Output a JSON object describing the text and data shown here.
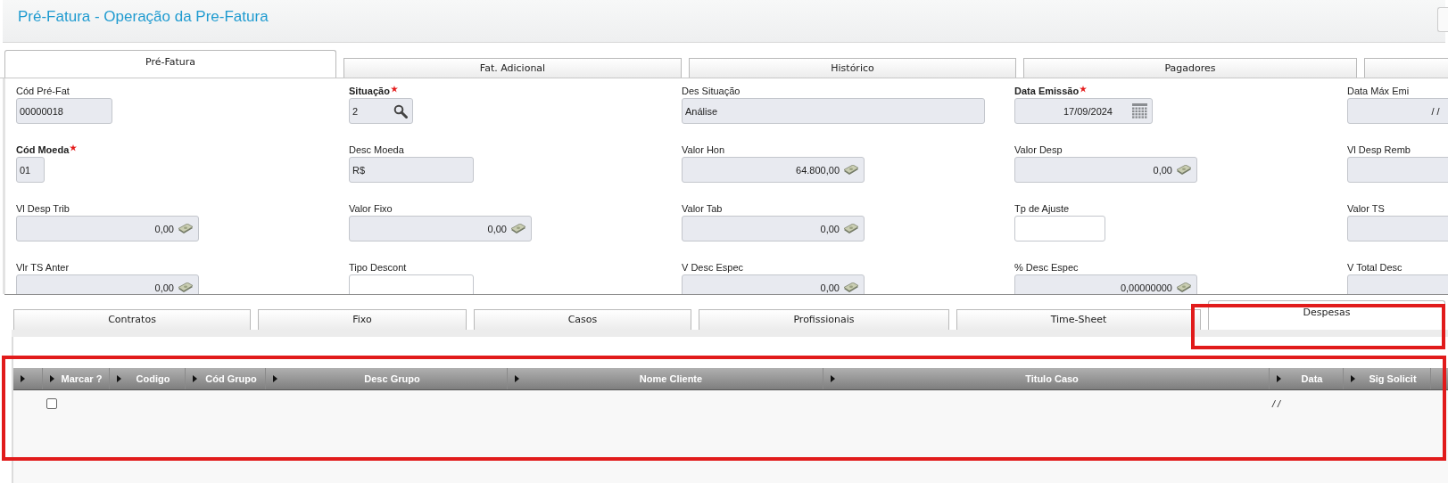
{
  "window": {
    "title": "Pré-Fatura - Operação da Pre-Fatura"
  },
  "tabs": [
    {
      "label": "Pré-Fatura",
      "selected": true
    },
    {
      "label": "Fat. Adicional",
      "selected": false
    },
    {
      "label": "Histórico",
      "selected": false
    },
    {
      "label": "Pagadores",
      "selected": false
    }
  ],
  "form": {
    "rows": [
      [
        {
          "label": "Cód Pré-Fat",
          "required": false,
          "kind": "text",
          "editable": false,
          "value": "00000018"
        },
        {
          "label": "Situação",
          "required": true,
          "kind": "lookup",
          "editable": false,
          "value": "2"
        },
        {
          "label": "Des Situação",
          "required": false,
          "kind": "text",
          "editable": false,
          "value": "Análise"
        },
        {
          "label": "Data Emissão",
          "required": true,
          "kind": "date",
          "editable": false,
          "value": "17/09/2024"
        },
        {
          "label": "Data Máx Emi",
          "required": false,
          "kind": "date-plain",
          "editable": false,
          "value": "/ /"
        }
      ],
      [
        {
          "label": "Cód Moeda",
          "required": true,
          "kind": "text",
          "editable": false,
          "value": "01"
        },
        {
          "label": "Desc Moeda",
          "required": false,
          "kind": "text",
          "editable": false,
          "value": "R$"
        },
        {
          "label": "Valor Hon",
          "required": false,
          "kind": "money",
          "editable": false,
          "value": "64.800,00"
        },
        {
          "label": "Valor Desp",
          "required": false,
          "kind": "money",
          "editable": false,
          "value": "0,00"
        },
        {
          "label": "Vl Desp Remb",
          "required": false,
          "kind": "text",
          "editable": false
        }
      ],
      [
        {
          "label": "Vl Desp Trib",
          "required": false,
          "kind": "money",
          "editable": false,
          "value": "0,00"
        },
        {
          "label": "Valor Fixo",
          "required": false,
          "kind": "money",
          "editable": false,
          "value": "0,00"
        },
        {
          "label": "Valor Tab",
          "required": false,
          "kind": "money",
          "editable": false,
          "value": "0,00"
        },
        {
          "label": "Tp de Ajuste",
          "required": false,
          "kind": "text",
          "editable": true
        },
        {
          "label": "Valor TS",
          "required": false,
          "kind": "text",
          "editable": false
        }
      ],
      [
        {
          "label": "Vlr TS Anter",
          "required": false,
          "kind": "money",
          "editable": false,
          "value": "0,00"
        },
        {
          "label": "Tipo Descont",
          "required": false,
          "kind": "text",
          "editable": true
        },
        {
          "label": "V Desc Espec",
          "required": false,
          "kind": "money",
          "editable": false,
          "value": "0,00"
        },
        {
          "label": "% Desc Espec",
          "required": false,
          "kind": "money",
          "editable": false,
          "value": "0,00000000"
        },
        {
          "label": "V Total Desc",
          "required": false,
          "kind": "text",
          "editable": false
        }
      ]
    ]
  },
  "subtabs": [
    {
      "label": "Contratos",
      "selected": false
    },
    {
      "label": "Fixo",
      "selected": false
    },
    {
      "label": "Casos",
      "selected": false
    },
    {
      "label": "Profissionais",
      "selected": false
    },
    {
      "label": "Time-Sheet",
      "selected": false
    },
    {
      "label": "Despesas",
      "selected": true
    }
  ],
  "table": {
    "columns": [
      {
        "label": "Marcar ?",
        "kind": "check"
      },
      {
        "label": "Codigo",
        "kind": "text"
      },
      {
        "label": "Cód Grupo",
        "kind": "text"
      },
      {
        "label": "Desc Grupo",
        "kind": "text"
      },
      {
        "label": "Nome Cliente",
        "kind": "text"
      },
      {
        "label": "Titulo Caso",
        "kind": "text"
      },
      {
        "label": "Data",
        "kind": "date"
      },
      {
        "label": "Sig Solicit",
        "kind": "text"
      }
    ],
    "rows": [
      {
        "checked": false,
        "date": "/ /"
      }
    ]
  }
}
